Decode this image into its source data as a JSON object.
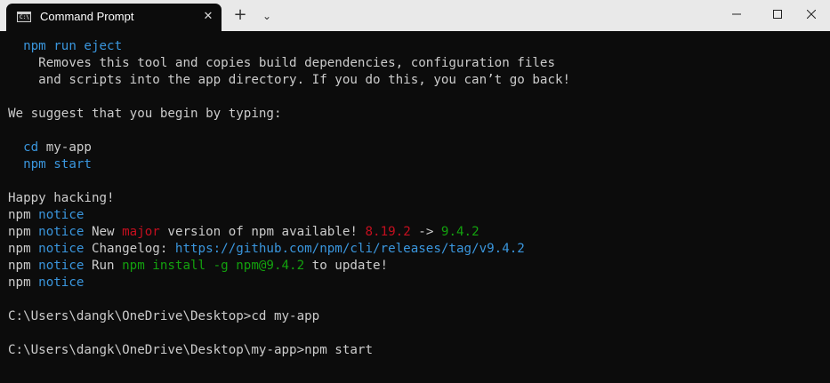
{
  "window": {
    "tab_title": "Command Prompt",
    "tab_icon_glyph": "C:\\",
    "close_tab_glyph": "✕",
    "new_tab_glyph": "+",
    "dropdown_glyph": "⌄"
  },
  "colors": {
    "background": "#0c0c0c",
    "text": "#cccccc",
    "blue": "#3a96dd",
    "red": "#c50f1f",
    "green": "#13a10e"
  },
  "terminal": {
    "lines": [
      [
        {
          "t": "  "
        },
        {
          "t": "npm run eject",
          "c": "blue"
        }
      ],
      [
        {
          "t": "    Removes this tool and copies build dependencies, configuration files"
        }
      ],
      [
        {
          "t": "    and scripts into the app directory. If you do this, you can’t go back!"
        }
      ],
      [
        {
          "t": ""
        }
      ],
      [
        {
          "t": "We suggest that you begin by typing:"
        }
      ],
      [
        {
          "t": ""
        }
      ],
      [
        {
          "t": "  "
        },
        {
          "t": "cd",
          "c": "blue"
        },
        {
          "t": " my-app"
        }
      ],
      [
        {
          "t": "  "
        },
        {
          "t": "npm start",
          "c": "blue"
        }
      ],
      [
        {
          "t": ""
        }
      ],
      [
        {
          "t": "Happy hacking!"
        }
      ],
      [
        {
          "t": "npm "
        },
        {
          "t": "notice",
          "c": "blue"
        }
      ],
      [
        {
          "t": "npm "
        },
        {
          "t": "notice",
          "c": "blue"
        },
        {
          "t": " New "
        },
        {
          "t": "major",
          "c": "red"
        },
        {
          "t": " version of npm available! "
        },
        {
          "t": "8.19.2",
          "c": "red"
        },
        {
          "t": " -> "
        },
        {
          "t": "9.4.2",
          "c": "green"
        }
      ],
      [
        {
          "t": "npm "
        },
        {
          "t": "notice",
          "c": "blue"
        },
        {
          "t": " Changelog: "
        },
        {
          "t": "https://github.com/npm/cli/releases/tag/v9.4.2",
          "c": "blue"
        }
      ],
      [
        {
          "t": "npm "
        },
        {
          "t": "notice",
          "c": "blue"
        },
        {
          "t": " Run "
        },
        {
          "t": "npm install -g npm@9.4.2",
          "c": "green"
        },
        {
          "t": " to update!"
        }
      ],
      [
        {
          "t": "npm "
        },
        {
          "t": "notice",
          "c": "blue"
        }
      ],
      [
        {
          "t": ""
        }
      ],
      [
        {
          "t": "C:\\Users\\dangk\\OneDrive\\Desktop>cd my-app"
        }
      ],
      [
        {
          "t": ""
        }
      ],
      [
        {
          "t": "C:\\Users\\dangk\\OneDrive\\Desktop\\my-app>npm start"
        }
      ]
    ]
  }
}
